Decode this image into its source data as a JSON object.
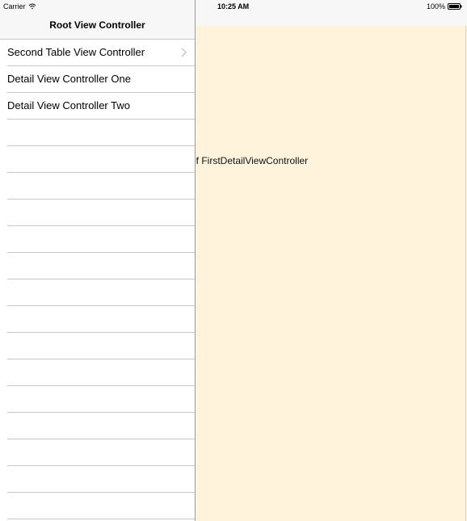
{
  "status_bar": {
    "carrier": "Carrier",
    "time": "10:25 AM",
    "battery": "100%",
    "wifi_icon": "wifi-icon",
    "battery_icon": "battery-icon"
  },
  "master": {
    "nav_title": "Root View Controller",
    "rows": [
      {
        "label": "Second Table View Controller",
        "accessory": "chevron-right-icon"
      },
      {
        "label": "Detail View Controller One"
      },
      {
        "label": "Detail View Controller Two"
      }
    ]
  },
  "detail": {
    "label": "of FirstDetailViewController",
    "background": "#fff3dc"
  }
}
